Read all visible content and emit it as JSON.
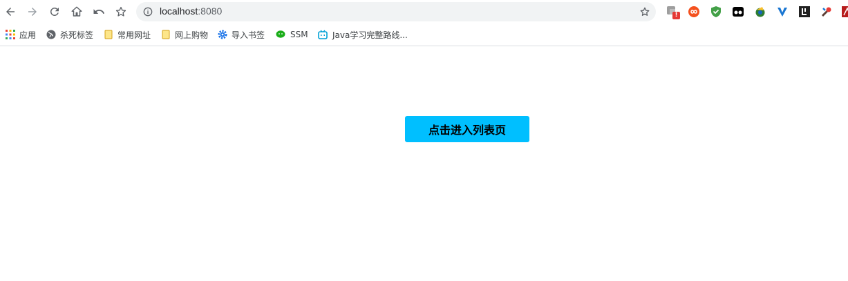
{
  "omnibox": {
    "host": "localhost",
    "port": ":8080",
    "info_icon": "info-icon",
    "bookmark_star": "star-icon"
  },
  "nav": {
    "back": "back-arrow-icon",
    "forward": "forward-arrow-icon",
    "reload": "reload-icon",
    "home": "home-icon",
    "undo": "undo-icon",
    "bookmark": "star-icon"
  },
  "bookmarks": [
    {
      "label": "应用",
      "icon": "apps-grid-icon"
    },
    {
      "label": "杀死标签",
      "icon": "globe-icon"
    },
    {
      "label": "常用网址",
      "icon": "folder-icon"
    },
    {
      "label": "网上购物",
      "icon": "folder-icon"
    },
    {
      "label": "导入书签",
      "icon": "gear-icon"
    },
    {
      "label": "SSM",
      "icon": "wechat-icon"
    },
    {
      "label": "Java学习完整路线...",
      "icon": "bilibili-icon"
    }
  ],
  "extensions": {
    "badge": "!"
  },
  "main": {
    "button_label": "点击进入列表页"
  }
}
